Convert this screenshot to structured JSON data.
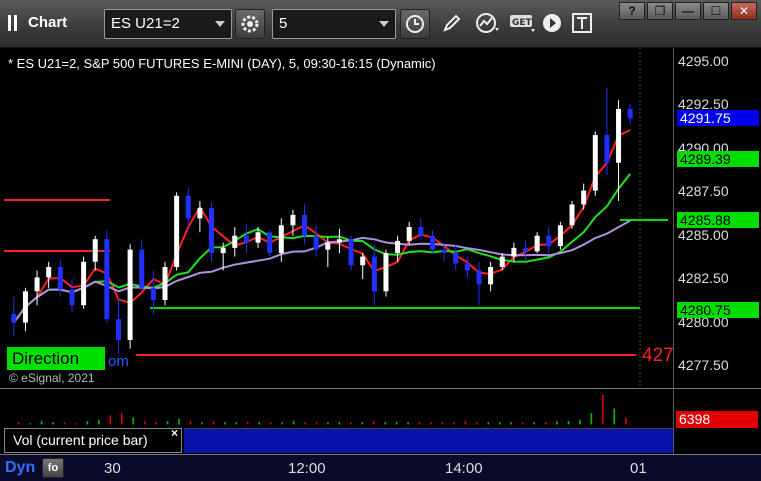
{
  "toolbar": {
    "title": "Chart",
    "symbol": "ES U21=2",
    "interval": "5",
    "buttons": [
      "time-icon",
      "pencil-icon",
      "chart-type-icon",
      "get-data-icon",
      "play-icon",
      "text-tool-icon"
    ]
  },
  "window_controls": {
    "help": "?",
    "restore": "❐",
    "minimize": "—",
    "maximize": "☐",
    "close": "✕"
  },
  "chart": {
    "description": "* ES U21=2, S&P 500 FUTURES E-MINI (DAY), 5, 09:30-16:15 (Dynamic)",
    "direction_label": "Direction",
    "direction_tail": "om",
    "red_level_label": "427",
    "copyright": "© eSignal, 2021",
    "price_ticks": [
      "4295.00",
      "4292.50",
      "4290.00",
      "4287.50",
      "4285.00",
      "4282.50",
      "4280.00",
      "4277.50"
    ],
    "price_tags": [
      {
        "value": "4291.75",
        "bg": "#0000ee",
        "fg": "#ffffff"
      },
      {
        "value": "4289.39",
        "bg": "#00dd00",
        "fg": "#000000"
      },
      {
        "value": "4285.88",
        "bg": "#00dd00",
        "fg": "#000000"
      },
      {
        "value": "4280.75",
        "bg": "#00dd00",
        "fg": "#000000"
      }
    ],
    "colors": {
      "up": "#ffffff",
      "down": "#2030ff",
      "ma_fast": "#ff2020",
      "ma_mid": "#20e020",
      "ma_slow": "#b090e0",
      "levels": "#00e000",
      "red_level": "#ff2020"
    }
  },
  "volume": {
    "legend": "Vol (current price bar)",
    "close": "×",
    "last_value": "6398"
  },
  "time_axis": {
    "dyn_label": "Dyn",
    "dyn_button": "fo",
    "labels": [
      "30",
      "12:00",
      "14:00",
      "01"
    ]
  },
  "chart_data": {
    "type": "candlestick",
    "ylim": [
      4276,
      4296
    ],
    "series": [
      {
        "name": "price",
        "ohlc": [
          [
            4280.5,
            4281.5,
            4279.2,
            4280.0
          ],
          [
            4280.0,
            4282.0,
            4279.5,
            4281.8
          ],
          [
            4281.8,
            4283.0,
            4281.0,
            4282.6
          ],
          [
            4282.6,
            4283.5,
            4282.0,
            4283.2
          ],
          [
            4283.2,
            4283.6,
            4281.5,
            4281.9
          ],
          [
            4281.9,
            4282.5,
            4280.6,
            4281.0
          ],
          [
            4281.0,
            4283.8,
            4280.8,
            4283.5
          ],
          [
            4283.5,
            4285.0,
            4283.0,
            4284.8
          ],
          [
            4284.8,
            4285.3,
            4280.0,
            4280.2
          ],
          [
            4280.2,
            4281.5,
            4278.2,
            4279.0
          ],
          [
            4279.0,
            4284.5,
            4278.5,
            4284.2
          ],
          [
            4284.2,
            4284.8,
            4281.8,
            4282.0
          ],
          [
            4282.0,
            4283.0,
            4280.5,
            4281.3
          ],
          [
            4281.3,
            4283.5,
            4281.0,
            4283.2
          ],
          [
            4283.2,
            4287.5,
            4283.0,
            4287.3
          ],
          [
            4287.3,
            4287.8,
            4285.5,
            4286.0
          ],
          [
            4286.0,
            4287.0,
            4285.2,
            4286.6
          ],
          [
            4286.6,
            4286.9,
            4283.5,
            4284.0
          ],
          [
            4284.0,
            4284.6,
            4283.0,
            4284.3
          ],
          [
            4284.3,
            4285.5,
            4283.8,
            4285.0
          ],
          [
            4285.0,
            4285.7,
            4284.0,
            4284.6
          ],
          [
            4284.6,
            4285.5,
            4284.3,
            4285.2
          ],
          [
            4285.2,
            4285.3,
            4283.8,
            4284.0
          ],
          [
            4284.0,
            4286.0,
            4283.5,
            4285.6
          ],
          [
            4285.6,
            4286.5,
            4285.0,
            4286.2
          ],
          [
            4286.2,
            4286.8,
            4284.5,
            4285.0
          ],
          [
            4285.0,
            4285.6,
            4283.8,
            4284.2
          ],
          [
            4284.2,
            4284.9,
            4283.2,
            4284.6
          ],
          [
            4284.6,
            4285.4,
            4284.0,
            4284.8
          ],
          [
            4284.8,
            4285.0,
            4283.0,
            4283.3
          ],
          [
            4283.3,
            4284.0,
            4282.5,
            4283.8
          ],
          [
            4283.8,
            4284.5,
            4281.0,
            4281.8
          ],
          [
            4281.8,
            4284.2,
            4281.5,
            4284.0
          ],
          [
            4284.0,
            4285.0,
            4283.5,
            4284.7
          ],
          [
            4284.7,
            4285.8,
            4284.5,
            4285.5
          ],
          [
            4285.5,
            4286.0,
            4284.8,
            4285.0
          ],
          [
            4285.0,
            4285.3,
            4284.0,
            4284.2
          ],
          [
            4284.2,
            4284.6,
            4283.5,
            4284.0
          ],
          [
            4284.0,
            4284.5,
            4283.0,
            4283.4
          ],
          [
            4283.4,
            4283.8,
            4282.6,
            4283.0
          ],
          [
            4283.0,
            4283.5,
            4281.0,
            4282.2
          ],
          [
            4282.2,
            4283.5,
            4281.8,
            4283.2
          ],
          [
            4283.2,
            4284.0,
            4283.0,
            4283.8
          ],
          [
            4283.8,
            4284.6,
            4283.5,
            4284.3
          ],
          [
            4284.3,
            4284.7,
            4283.6,
            4284.1
          ],
          [
            4284.1,
            4285.2,
            4284.0,
            4285.0
          ],
          [
            4285.0,
            4285.5,
            4284.0,
            4284.4
          ],
          [
            4284.4,
            4285.8,
            4284.2,
            4285.6
          ],
          [
            4285.6,
            4287.0,
            4285.4,
            4286.8
          ],
          [
            4286.8,
            4288.0,
            4286.5,
            4287.6
          ],
          [
            4287.6,
            4291.0,
            4287.3,
            4290.8
          ],
          [
            4290.8,
            4293.5,
            4288.5,
            4289.2
          ],
          [
            4289.2,
            4292.8,
            4287.0,
            4292.3
          ],
          [
            4292.3,
            4292.6,
            4291.4,
            4291.75
          ]
        ]
      }
    ],
    "volume": [
      2,
      1,
      3,
      2,
      2,
      1,
      3,
      4,
      8,
      10,
      6,
      3,
      2,
      3,
      5,
      3,
      2,
      3,
      2,
      2,
      2,
      2,
      2,
      2,
      3,
      2,
      2,
      2,
      2,
      2,
      2,
      3,
      2,
      2,
      2,
      2,
      2,
      2,
      2,
      3,
      2,
      2,
      2,
      2,
      2,
      2,
      2,
      3,
      3,
      4,
      10,
      26,
      14,
      6
    ]
  }
}
